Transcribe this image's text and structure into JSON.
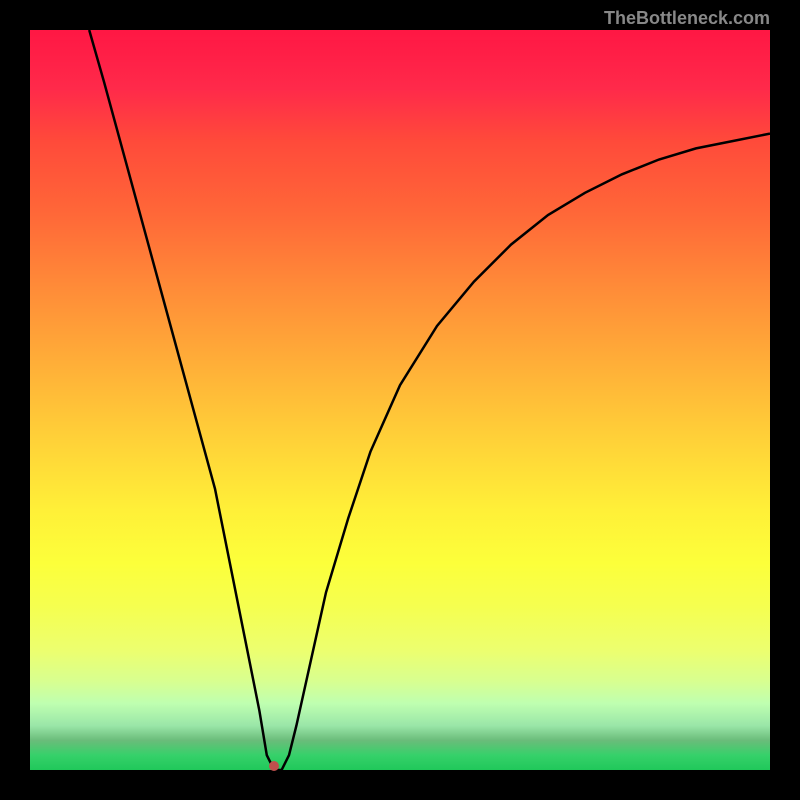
{
  "watermark": "TheBottleneck.com",
  "chart_data": {
    "type": "line",
    "title": "",
    "xlabel": "",
    "ylabel": "",
    "x_range": [
      0,
      100
    ],
    "y_range": [
      0,
      100
    ],
    "curve_points": [
      {
        "x": 8,
        "y": 100
      },
      {
        "x": 10,
        "y": 93
      },
      {
        "x": 13,
        "y": 82
      },
      {
        "x": 16,
        "y": 71
      },
      {
        "x": 19,
        "y": 60
      },
      {
        "x": 22,
        "y": 49
      },
      {
        "x": 25,
        "y": 38
      },
      {
        "x": 27,
        "y": 28
      },
      {
        "x": 29,
        "y": 18
      },
      {
        "x": 31,
        "y": 8
      },
      {
        "x": 32,
        "y": 2
      },
      {
        "x": 33,
        "y": 0
      },
      {
        "x": 34,
        "y": 0
      },
      {
        "x": 35,
        "y": 2
      },
      {
        "x": 36,
        "y": 6
      },
      {
        "x": 38,
        "y": 15
      },
      {
        "x": 40,
        "y": 24
      },
      {
        "x": 43,
        "y": 34
      },
      {
        "x": 46,
        "y": 43
      },
      {
        "x": 50,
        "y": 52
      },
      {
        "x": 55,
        "y": 60
      },
      {
        "x": 60,
        "y": 66
      },
      {
        "x": 65,
        "y": 71
      },
      {
        "x": 70,
        "y": 75
      },
      {
        "x": 75,
        "y": 78
      },
      {
        "x": 80,
        "y": 80.5
      },
      {
        "x": 85,
        "y": 82.5
      },
      {
        "x": 90,
        "y": 84
      },
      {
        "x": 95,
        "y": 85
      },
      {
        "x": 100,
        "y": 86
      }
    ],
    "marker": {
      "x": 33,
      "y": 0.5,
      "color": "#c0504d",
      "size": 10
    },
    "background_gradient": {
      "top": "#ff1744",
      "mid": "#ffd038",
      "bottom": "#20c85a"
    }
  }
}
